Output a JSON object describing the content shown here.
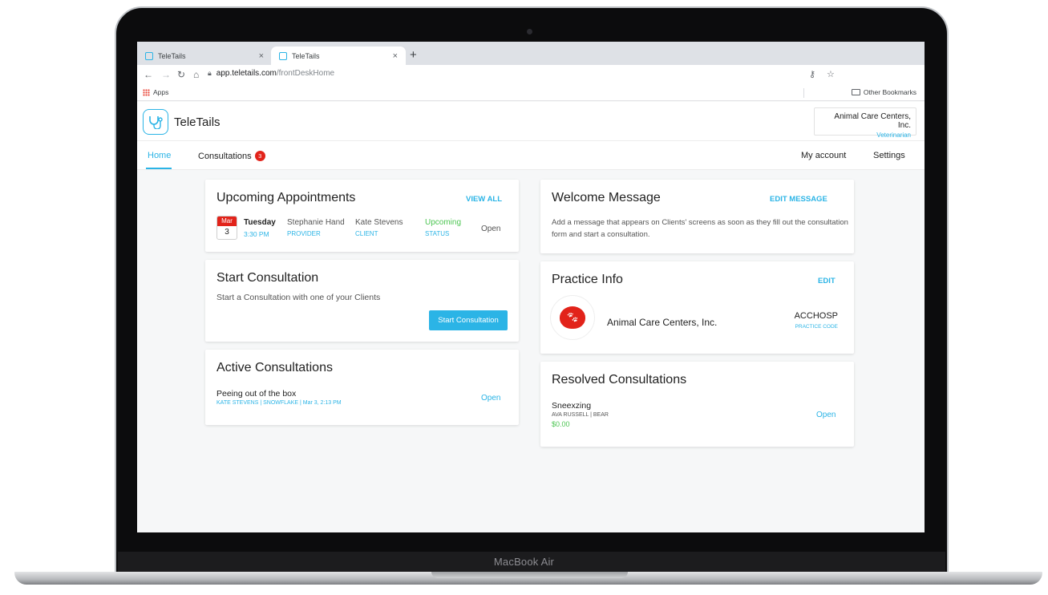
{
  "device": {
    "label": "MacBook Air"
  },
  "browser": {
    "tabs": [
      {
        "title": "TeleTails",
        "active": false
      },
      {
        "title": "TeleTails",
        "active": true
      }
    ],
    "url_host": "app.teletails.com",
    "url_path": "/frontDeskHome",
    "bookmarks": {
      "apps": "Apps",
      "other": "Other Bookmarks"
    }
  },
  "app": {
    "name": "TeleTails",
    "org_name": "Animal Care Centers, Inc.",
    "org_role": "Veterinarian",
    "nav": {
      "home": "Home",
      "consultations": "Consultations",
      "consultations_badge": "3",
      "my_account": "My account",
      "settings": "Settings"
    }
  },
  "upcoming": {
    "title": "Upcoming Appointments",
    "view_all": "VIEW ALL",
    "appointment": {
      "month": "Mar",
      "day": "3",
      "weekday": "Tuesday",
      "time": "3:30 PM",
      "provider": "Stephanie Hand",
      "provider_label": "PROVIDER",
      "client": "Kate Stevens",
      "client_label": "CLIENT",
      "status": "Upcoming",
      "status_label": "STATUS",
      "action": "Open"
    }
  },
  "start": {
    "title": "Start Consultation",
    "description": "Start a Consultation with one of your Clients",
    "button": "Start Consultation"
  },
  "active": {
    "title": "Active Consultations",
    "item": {
      "title": "Peeing out of the box",
      "meta": "KATE STEVENS | SNOWFLAKE | Mar 3, 2:13 PM",
      "action": "Open"
    }
  },
  "welcome": {
    "title": "Welcome Message",
    "edit": "EDIT MESSAGE",
    "body": "Add a message that appears on Clients' screens as soon as they fill out the consultation form and start a consultation."
  },
  "practice": {
    "title": "Practice Info",
    "edit": "EDIT",
    "name": "Animal Care Centers, Inc.",
    "code": "ACCHOSP",
    "code_label": "PRACTICE CODE"
  },
  "resolved": {
    "title": "Resolved Consultations",
    "item": {
      "title": "Sneexzing",
      "meta": "AVA RUSSELL | BEAR",
      "amount": "$0.00",
      "action": "Open"
    }
  },
  "colors": {
    "accent": "#2bb4e6",
    "badge": "#e2231a",
    "status_green": "#4cc552"
  },
  "icons": [
    "back-arrow-icon",
    "forward-arrow-icon",
    "reload-icon",
    "home-icon",
    "lock-icon",
    "key-icon",
    "star-icon",
    "apps-grid-icon",
    "folder-icon",
    "stethoscope-logo-icon",
    "paw-heart-icon"
  ]
}
